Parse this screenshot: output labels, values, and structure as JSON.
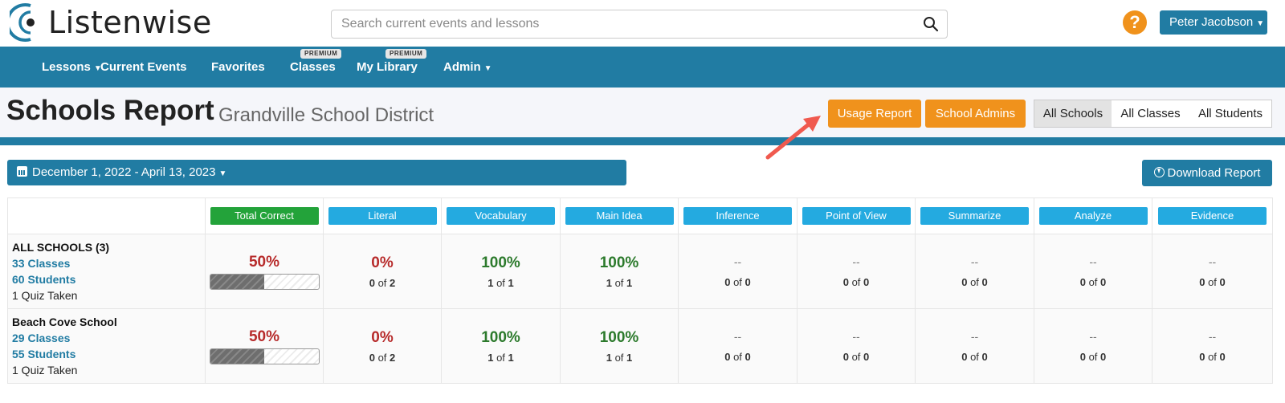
{
  "app": {
    "logo_text": "Listenwise"
  },
  "search": {
    "placeholder": "Search current events and lessons"
  },
  "header": {
    "help_label": "?",
    "user_name": "Peter Jacobson"
  },
  "nav": {
    "lessons": "Lessons",
    "current_events": "Current Events",
    "favorites": "Favorites",
    "classes": "Classes",
    "classes_badge": "PREMIUM",
    "my_library": "My Library",
    "my_library_badge": "PREMIUM",
    "admin": "Admin"
  },
  "page": {
    "title": "Schools Report",
    "subtitle": "Grandville School District",
    "usage_report": "Usage Report",
    "school_admins": "School Admins",
    "seg_all_schools": "All Schools",
    "seg_all_classes": "All Classes",
    "seg_all_students": "All Students"
  },
  "controls": {
    "date_range": "December 1, 2022 - April 13, 2023",
    "download": "Download Report"
  },
  "table": {
    "headers": {
      "total": "Total Correct",
      "literal": "Literal",
      "vocabulary": "Vocabulary",
      "main_idea": "Main Idea",
      "inference": "Inference",
      "point_of_view": "Point of View",
      "summarize": "Summarize",
      "analyze": "Analyze",
      "evidence": "Evidence"
    },
    "rows": [
      {
        "name": "ALL SCHOOLS (3)",
        "classes": "33 Classes",
        "students": "60 Students",
        "quizzes": "1 Quiz Taken",
        "total_pct": "50%",
        "total_progress": 0.5,
        "literal": {
          "pct": "0%",
          "correct": "0",
          "of": "of",
          "total": "2"
        },
        "vocabulary": {
          "pct": "100%",
          "correct": "1",
          "of": "of",
          "total": "1"
        },
        "main_idea": {
          "pct": "100%",
          "correct": "1",
          "of": "of",
          "total": "1"
        },
        "inference": {
          "pct": "--",
          "correct": "0",
          "of": "of",
          "total": "0"
        },
        "point_of_view": {
          "pct": "--",
          "correct": "0",
          "of": "of",
          "total": "0"
        },
        "summarize": {
          "pct": "--",
          "correct": "0",
          "of": "of",
          "total": "0"
        },
        "analyze": {
          "pct": "--",
          "correct": "0",
          "of": "of",
          "total": "0"
        },
        "evidence": {
          "pct": "--",
          "correct": "0",
          "of": "of",
          "total": "0"
        }
      },
      {
        "name": "Beach Cove School",
        "classes": "29 Classes",
        "students": "55 Students",
        "quizzes": "1 Quiz Taken",
        "total_pct": "50%",
        "total_progress": 0.5,
        "literal": {
          "pct": "0%",
          "correct": "0",
          "of": "of",
          "total": "2"
        },
        "vocabulary": {
          "pct": "100%",
          "correct": "1",
          "of": "of",
          "total": "1"
        },
        "main_idea": {
          "pct": "100%",
          "correct": "1",
          "of": "of",
          "total": "1"
        },
        "inference": {
          "pct": "--",
          "correct": "0",
          "of": "of",
          "total": "0"
        },
        "point_of_view": {
          "pct": "--",
          "correct": "0",
          "of": "of",
          "total": "0"
        },
        "summarize": {
          "pct": "--",
          "correct": "0",
          "of": "of",
          "total": "0"
        },
        "analyze": {
          "pct": "--",
          "correct": "0",
          "of": "of",
          "total": "0"
        },
        "evidence": {
          "pct": "--",
          "correct": "0",
          "of": "of",
          "total": "0"
        }
      }
    ]
  },
  "colors": {
    "brand_blue": "#217ca3",
    "accent_orange": "#f0921c",
    "header_pill_blue": "#24aae0",
    "header_pill_green": "#23a33a",
    "low_score_red": "#b72b2b",
    "high_score_green": "#2c7a2c",
    "annotation_arrow": "#f05a4f"
  },
  "icons": {
    "search": "search-icon",
    "help": "question-circle-icon",
    "calendar": "calendar-icon",
    "download": "download-icon"
  }
}
